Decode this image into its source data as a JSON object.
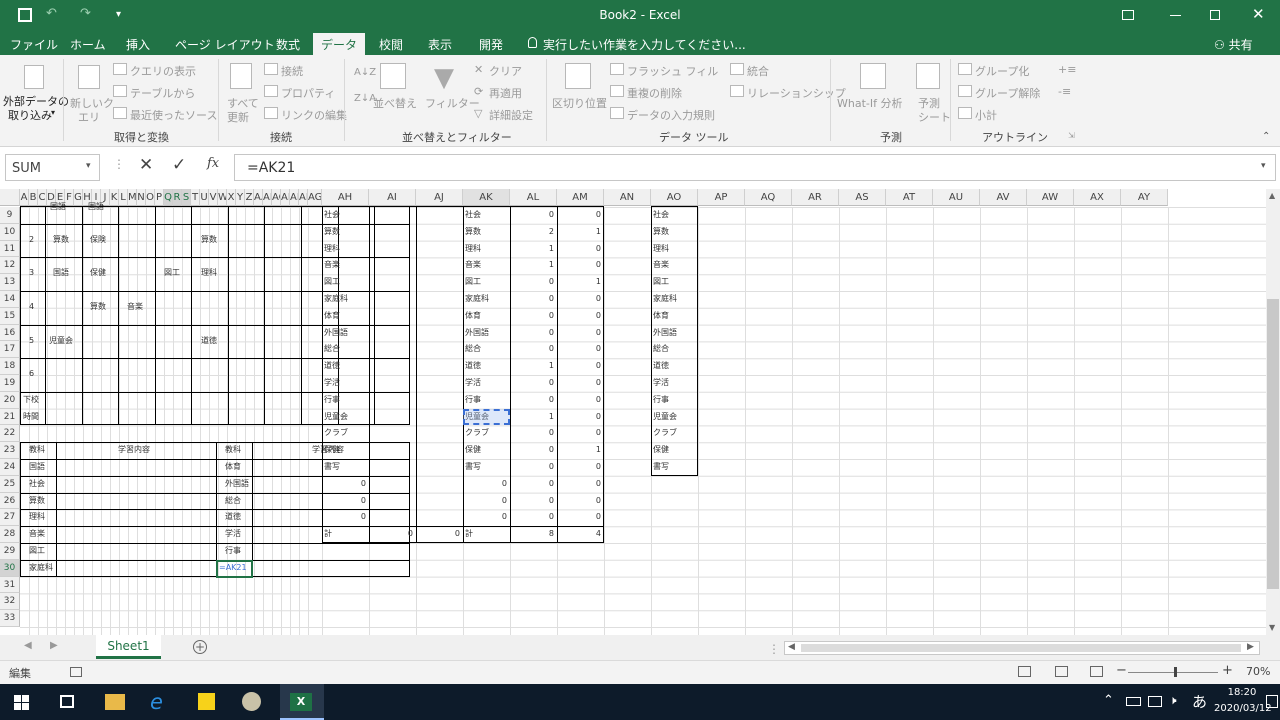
{
  "title": "Book2  -  Excel",
  "tabs": [
    "ファイル",
    "ホーム",
    "挿入",
    "ページ レイアウト",
    "数式",
    "データ",
    "校閲",
    "表示",
    "開発"
  ],
  "tell_me": "実行したい作業を入力してください...",
  "share": "共有",
  "ribbon": {
    "ext_l1": "外部データの",
    "ext_l2": "取り込み",
    "new_q1": "新しいク",
    "new_q2": "エリ",
    "show_q": "クエリの表示",
    "from_table": "テーブルから",
    "recent": "最近使ったソース",
    "refresh1": "すべて",
    "refresh2": "更新",
    "connections": "接続",
    "properties": "プロパティ",
    "edit_links": "リンクの編集",
    "sort": "並べ替え",
    "filter": "フィルター",
    "clear": "クリア",
    "reapply": "再適用",
    "advanced": "詳細設定",
    "text_cols": "区切り位置",
    "flash": "フラッシュ フィル",
    "remove_dup": "重複の削除",
    "validation": "データの入力規則",
    "consolidate": "統合",
    "relationships": "リレーションシップ",
    "whatif": "What-If 分析",
    "forecast1": "予測",
    "forecast2": "シート",
    "group": "グループ化",
    "ungroup": "グループ解除",
    "subtotal": "小計",
    "g_get": "取得と変換",
    "g_conn": "接続",
    "g_sort": "並べ替えとフィルター",
    "g_tools": "データ ツール",
    "g_forecast": "予測",
    "g_outline": "アウトライン"
  },
  "namebox": "SUM",
  "formula": "=AK21",
  "narrow_cols": [
    "A",
    "B",
    "C",
    "D",
    "E",
    "F",
    "G",
    "H",
    "I",
    "J",
    "K",
    "L",
    "M",
    "N",
    "O",
    "P",
    "Q",
    "R",
    "S",
    "T",
    "U",
    "V",
    "W",
    "X",
    "Y",
    "Z",
    "AA",
    "AB",
    "AC",
    "AD",
    "AE",
    "AF",
    "AG"
  ],
  "wide_cols": [
    "AH",
    "AI",
    "AJ",
    "AK",
    "AL",
    "AM",
    "AN",
    "AO",
    "AP",
    "AQ",
    "AR",
    "AS",
    "AT",
    "AU",
    "AV",
    "AW",
    "AX",
    "AY"
  ],
  "rows": [
    "9",
    "10",
    "11",
    "12",
    "13",
    "14",
    "15",
    "16",
    "17",
    "18",
    "19",
    "20",
    "21",
    "22",
    "23",
    "24",
    "25",
    "26",
    "27",
    "28",
    "29",
    "30",
    "31",
    "32",
    "33"
  ],
  "left_table": {
    "periods": [
      "2",
      "3",
      "4",
      "5",
      "6"
    ],
    "top_partial": [
      "国語",
      "国語"
    ],
    "p2": [
      "算数",
      "保険",
      "算数"
    ],
    "p3": [
      "国語",
      "保健",
      "図工",
      "理科"
    ],
    "p4": [
      "算数",
      "音楽"
    ],
    "p5": [
      "児童会",
      "道徳"
    ],
    "after_school": [
      "下校",
      "時間"
    ]
  },
  "lower_table": {
    "h1": "教科",
    "h2": "学習内容",
    "h3": "教科",
    "h4": "学習内容",
    "left_subjects": [
      "国語",
      "社会",
      "算数",
      "理科",
      "音楽",
      "図工",
      "家庭科"
    ],
    "right_subjects": [
      "体育",
      "外国語",
      "総合",
      "道徳",
      "学活",
      "行事"
    ],
    "editing": "=AK21"
  },
  "ah_col": [
    "社会",
    "算数",
    "理科",
    "音楽",
    "図工",
    "家庭科",
    "体育",
    "外国語",
    "総合",
    "道徳",
    "学活",
    "行事",
    "児童会",
    "クラブ",
    "保健",
    "書写",
    "0",
    "0",
    "0",
    "計"
  ],
  "ak_col": [
    "社会",
    "算数",
    "理科",
    "音楽",
    "図工",
    "家庭科",
    "体育",
    "外国語",
    "総合",
    "道徳",
    "学活",
    "行事",
    "児童会",
    "クラブ",
    "保健",
    "書写",
    "0",
    "0",
    "0",
    "計"
  ],
  "al_col": [
    "0",
    "2",
    "1",
    "1",
    "0",
    "0",
    "0",
    "0",
    "0",
    "1",
    "0",
    "0",
    "1",
    "0",
    "0",
    "0",
    "0",
    "0",
    "0",
    "8"
  ],
  "am_col": [
    "0",
    "1",
    "0",
    "0",
    "1",
    "0",
    "0",
    "0",
    "0",
    "0",
    "0",
    "0",
    "0",
    "0",
    "1",
    "0",
    "0",
    "0",
    "0",
    "4"
  ],
  "ai_total": "0",
  "aj_total": "0",
  "ao_col": [
    "社会",
    "算数",
    "理科",
    "音楽",
    "図工",
    "家庭科",
    "体育",
    "外国語",
    "総合",
    "道徳",
    "学活",
    "行事",
    "児童会",
    "クラブ",
    "保健",
    "書写"
  ],
  "sheet_tab": "Sheet1",
  "status_mode": "編集",
  "zoom": "70%",
  "clock_time": "18:20",
  "clock_date": "2020/03/12",
  "ime": "あ"
}
